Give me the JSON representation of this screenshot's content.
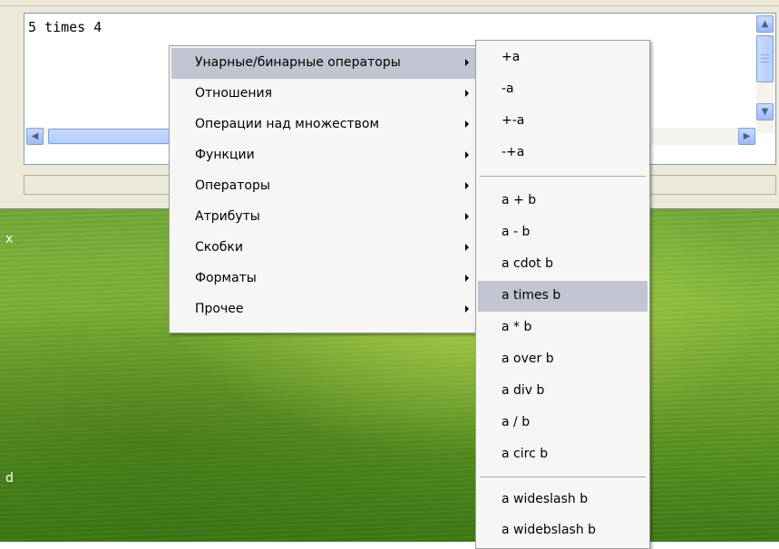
{
  "editor": {
    "text": "5 times 4"
  },
  "desktop": {
    "label_x": "x",
    "label_d": "d"
  },
  "main_menu": {
    "items": [
      {
        "label": "Унарные/бинарные операторы"
      },
      {
        "label": "Отношения"
      },
      {
        "label": "Операции над множеством"
      },
      {
        "label": "Функции"
      },
      {
        "label": "Операторы"
      },
      {
        "label": "Атрибуты"
      },
      {
        "label": "Скобки"
      },
      {
        "label": "Форматы"
      },
      {
        "label": "Прочее"
      }
    ]
  },
  "sub_menu": {
    "items": [
      {
        "label": "+a"
      },
      {
        "label": "-a"
      },
      {
        "label": "+-a"
      },
      {
        "label": "-+a"
      },
      {
        "label": "a + b"
      },
      {
        "label": "a - b"
      },
      {
        "label": "a cdot b"
      },
      {
        "label": "a times b"
      },
      {
        "label": "a * b"
      },
      {
        "label": "a over b"
      },
      {
        "label": "a div b"
      },
      {
        "label": "a / b"
      },
      {
        "label": "a circ b"
      },
      {
        "label": "a wideslash b"
      },
      {
        "label": "a widebslash b"
      }
    ]
  },
  "icons": {
    "scroll_up": "chevron-up-icon",
    "scroll_down": "chevron-down-icon",
    "scroll_left": "chevron-left-icon",
    "scroll_right": "chevron-right-icon",
    "submenu_arrow": "submenu-arrow-icon"
  },
  "colors": {
    "menu_highlight": "#c1c5d2",
    "menu_background": "#f6f6f4",
    "window_chrome": "#ece9d8",
    "scrollbar_blue": "#b4cdfb",
    "desktop_green": "#6fa838"
  }
}
